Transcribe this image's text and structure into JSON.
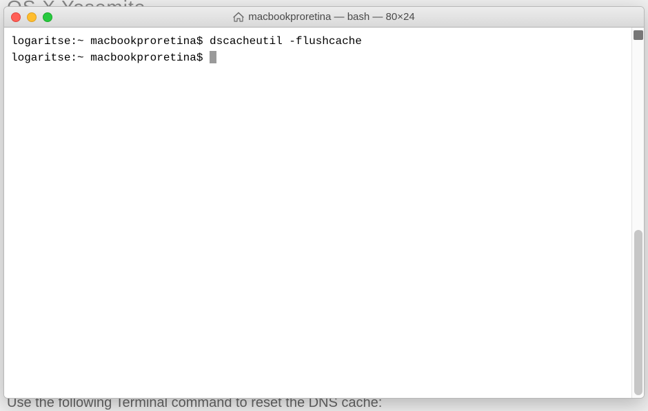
{
  "behind": {
    "top": "OS X Yosemite",
    "bottom": "Use the following Terminal command to reset the DNS cache:"
  },
  "window": {
    "title": "macbookproretina — bash — 80×24"
  },
  "terminal": {
    "lines": [
      {
        "prompt": "logaritse:~ macbookproretina$ ",
        "command": "dscacheutil -flushcache"
      },
      {
        "prompt": "logaritse:~ macbookproretina$ ",
        "command": ""
      }
    ]
  }
}
